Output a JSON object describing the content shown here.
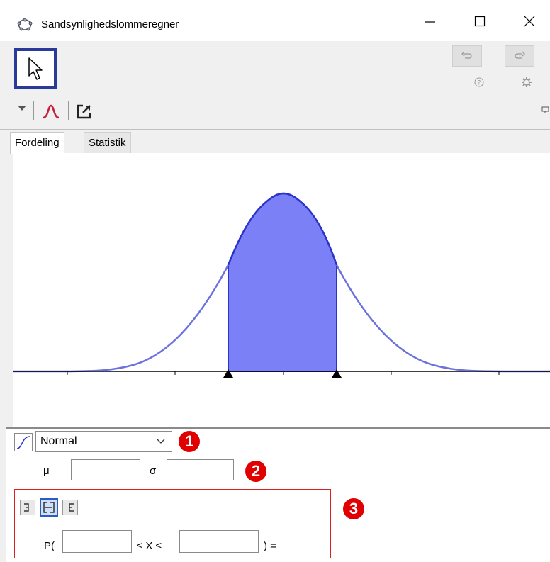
{
  "window": {
    "title": "Sandsynlighedslommeregner"
  },
  "tabs": [
    {
      "label": "Fordeling"
    },
    {
      "label": "Statistik"
    }
  ],
  "distribution": {
    "selected": "Normal"
  },
  "parameters": {
    "mu_label": "μ",
    "mu_value": "",
    "sigma_label": "σ",
    "sigma_value": ""
  },
  "probability": {
    "prefix": "P(",
    "middle": "≤ X ≤",
    "suffix": ") =",
    "lower_value": "",
    "upper_value": ""
  },
  "annotations": {
    "badge1": "1",
    "badge2": "2",
    "badge3": "3"
  },
  "colors": {
    "curve": "#2a34c8",
    "fill": "#7b80f7",
    "highlight_box": "#e02020",
    "badge": "#e00000"
  },
  "icons": {
    "app": "geogebra-icon",
    "minimize": "minimize-icon",
    "maximize": "maximize-icon",
    "close": "close-icon",
    "move_tool": "cursor-arrow-icon",
    "undo": "undo-icon",
    "redo": "redo-icon",
    "help": "help-icon",
    "settings": "gear-icon",
    "view_menu": "triangle-down-icon",
    "graph_view": "normal-curve-icon",
    "export": "export-icon",
    "style_bar": "style-bar-icon",
    "cumulative": "cumulative-icon",
    "left_sided": "left-sided-icon",
    "interval": "interval-icon",
    "right_sided": "right-sided-icon"
  }
}
